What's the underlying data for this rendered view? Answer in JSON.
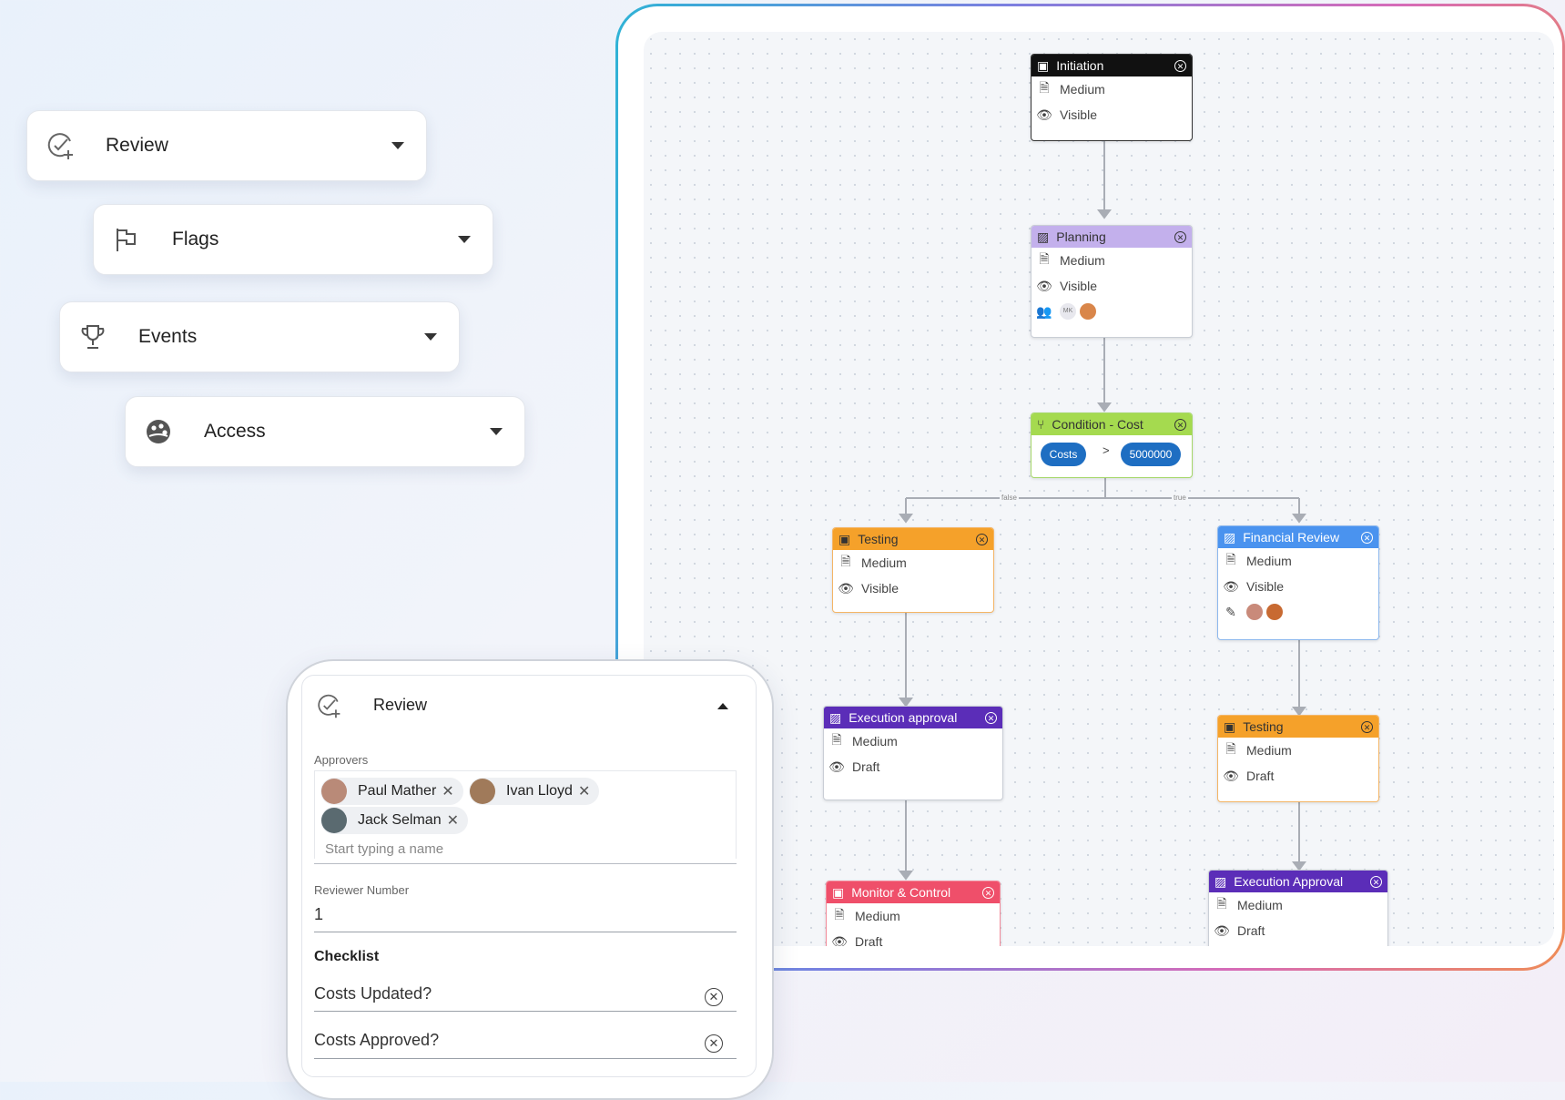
{
  "dropdowns": [
    {
      "label": "Review",
      "icon": "check-plus-icon"
    },
    {
      "label": "Flags",
      "icon": "flag-icon"
    },
    {
      "label": "Events",
      "icon": "trophy-icon"
    },
    {
      "label": "Access",
      "icon": "palette-icon"
    }
  ],
  "flow": {
    "nodes": {
      "initiation": {
        "title": "Initiation",
        "rows": [
          "Medium",
          "Visible"
        ],
        "color": "#111111"
      },
      "planning": {
        "title": "Planning",
        "rows": [
          "Medium",
          "Visible"
        ],
        "color": "#b9a3e6",
        "avatar_initials": "MK"
      },
      "condition": {
        "title": "Condition - Cost",
        "color": "#9fd84a",
        "left": "Costs",
        "op": ">",
        "right": "5000000"
      },
      "testing1": {
        "title": "Testing",
        "rows": [
          "Medium",
          "Visible"
        ],
        "color": "#f39a1c"
      },
      "financial": {
        "title": "Financial Review",
        "rows": [
          "Medium",
          "Visible"
        ],
        "color": "#3f8ff0"
      },
      "exec1": {
        "title": "Execution approval",
        "rows": [
          "Medium",
          "Draft"
        ],
        "color": "#5b2db8"
      },
      "testing2": {
        "title": "Testing",
        "rows": [
          "Medium",
          "Draft"
        ],
        "color": "#f39a1c"
      },
      "monitor": {
        "title": "Monitor & Control",
        "rows": [
          "Medium",
          "Draft"
        ],
        "color": "#ef4f6a"
      },
      "exec2": {
        "title": "Execution Approval",
        "rows": [
          "Medium",
          "Draft"
        ],
        "color": "#5b2db8"
      }
    },
    "edge_labels": {
      "false": "false",
      "true": "true"
    }
  },
  "review_panel": {
    "title": "Review",
    "approvers_label": "Approvers",
    "approvers": [
      "Paul Mather",
      "Ivan Lloyd",
      "Jack Selman"
    ],
    "approver_placeholder": "Start typing a name",
    "reviewer_number_label": "Reviewer Number",
    "reviewer_number": "1",
    "checklist_label": "Checklist",
    "checklist": [
      "Costs Updated?",
      "Costs Approved?"
    ]
  }
}
